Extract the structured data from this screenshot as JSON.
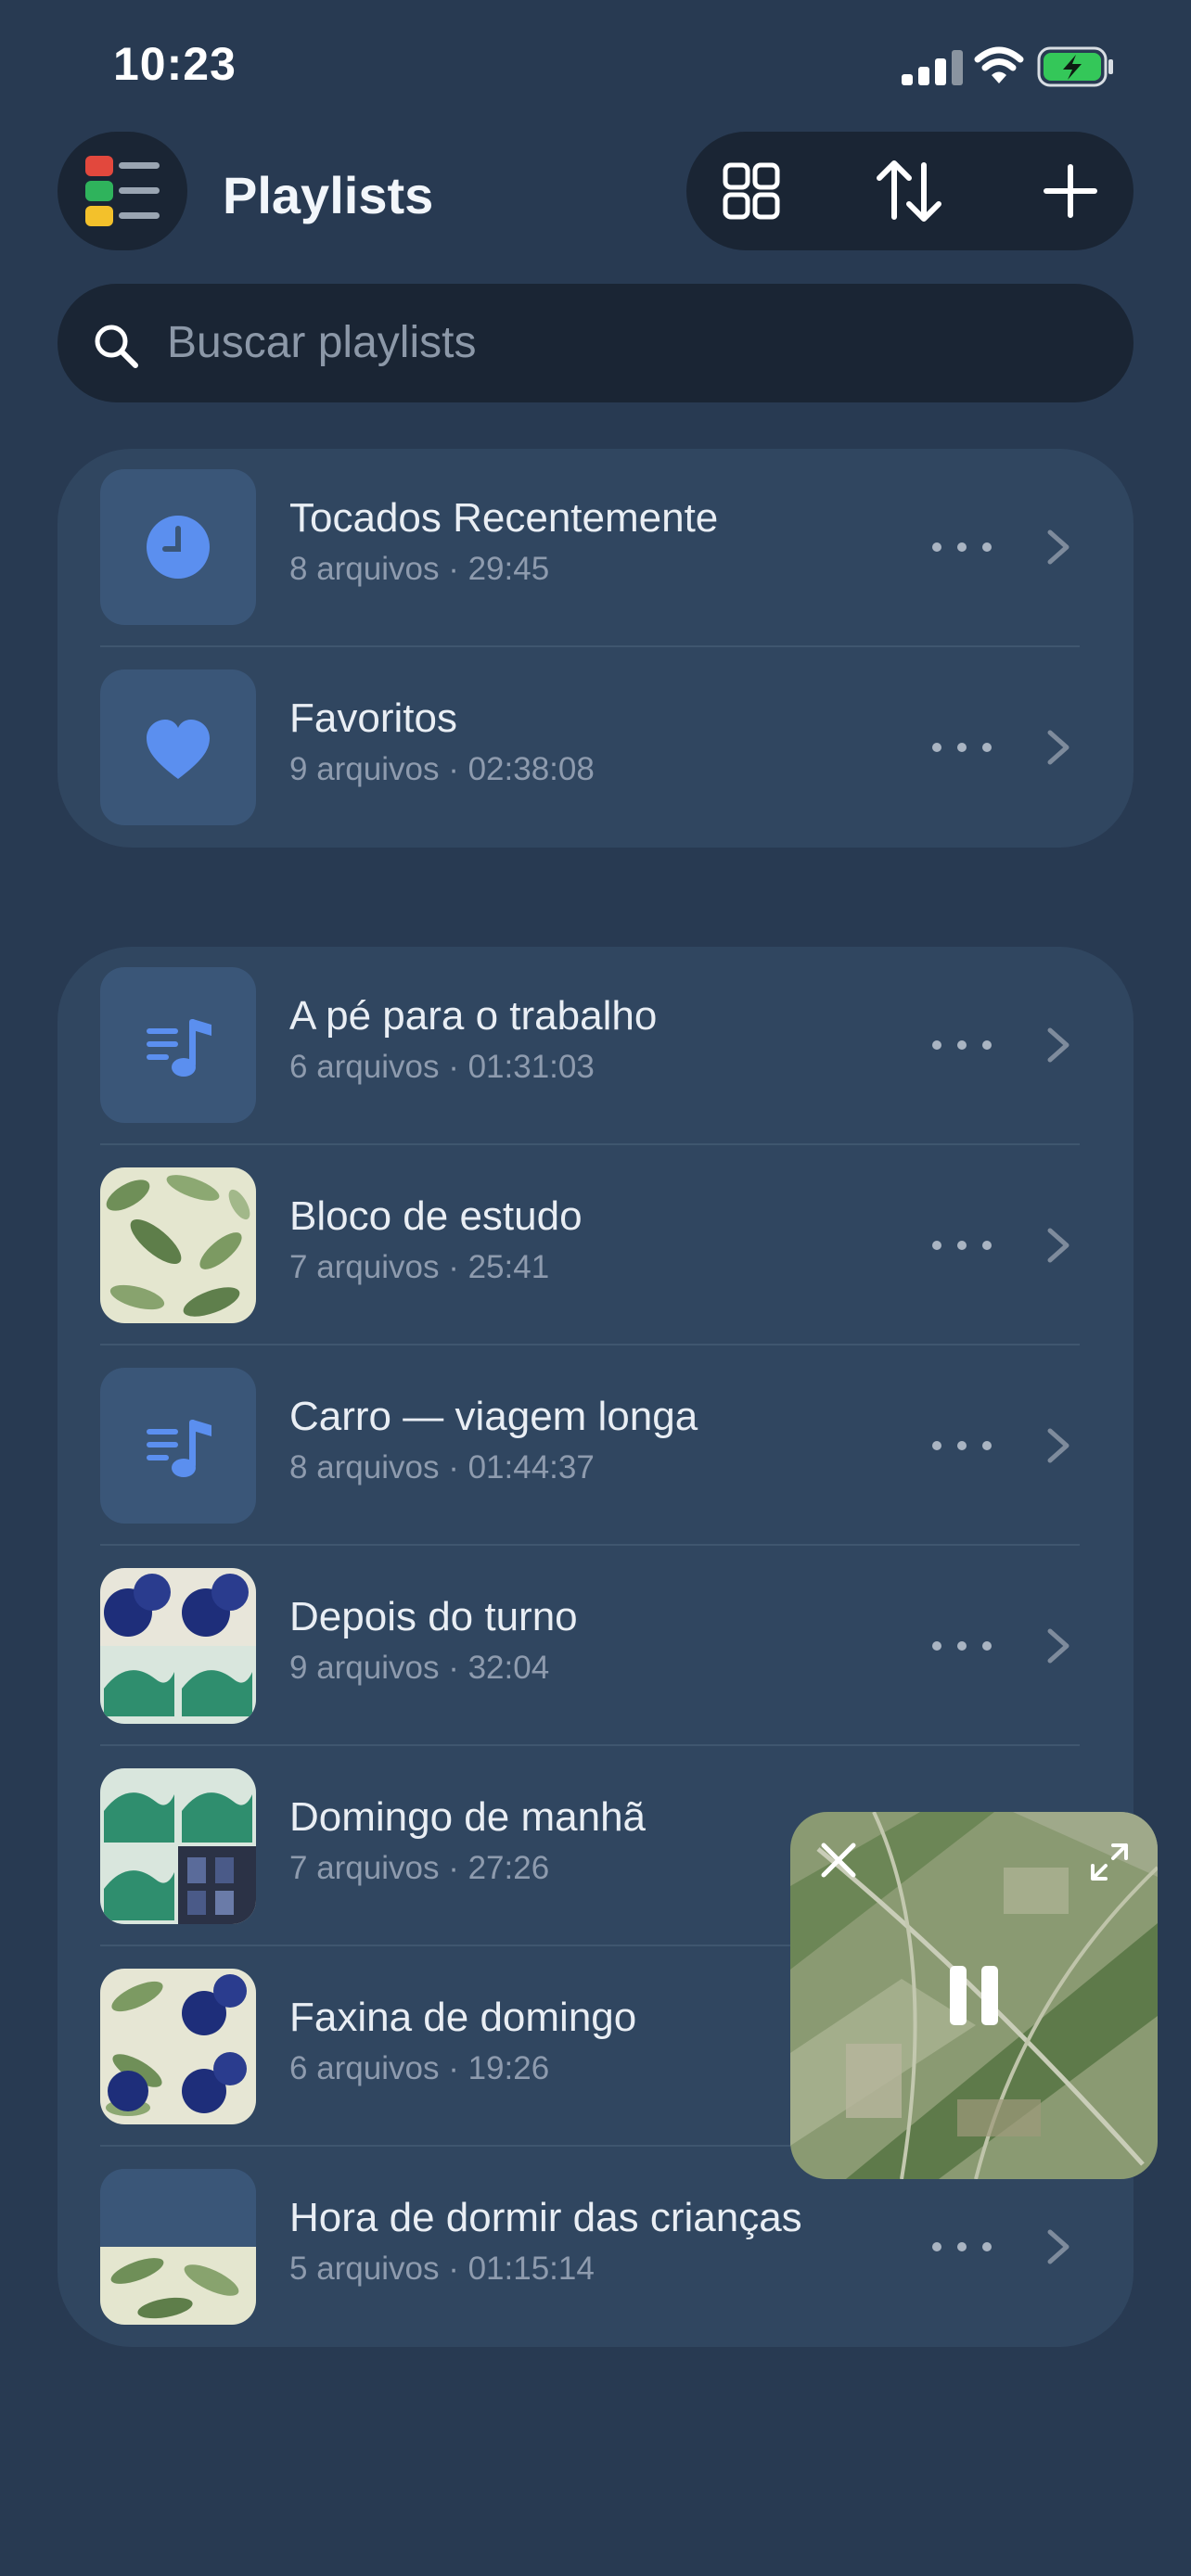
{
  "status_bar": {
    "time": "10:23",
    "battery": "charging"
  },
  "header": {
    "title": "Playlists",
    "menu_icon": "colored-list-menu-icon",
    "actions": [
      {
        "name": "grid-view",
        "icon": "grid-icon"
      },
      {
        "name": "sort",
        "icon": "sort-arrows-icon"
      },
      {
        "name": "add",
        "icon": "plus-icon"
      }
    ]
  },
  "search": {
    "placeholder": "Buscar playlists",
    "value": ""
  },
  "system_playlists": [
    {
      "name": "Tocados Recentemente",
      "meta": "8 arquivos · 29:45",
      "icon": "clock-icon"
    },
    {
      "name": "Favoritos",
      "meta": "9 arquivos · 02:38:08",
      "icon": "heart-icon"
    }
  ],
  "playlists": [
    {
      "name": "A pé para o trabalho",
      "meta": "6 arquivos · 01:31:03",
      "thumb": "music-list-icon"
    },
    {
      "name": "Bloco de estudo",
      "meta": "7 arquivos · 25:41",
      "thumb": "artwork-leaves"
    },
    {
      "name": "Carro — viagem longa",
      "meta": "8 arquivos · 01:44:37",
      "thumb": "music-list-icon"
    },
    {
      "name": "Depois do turno",
      "meta": "9 arquivos · 32:04",
      "thumb": "artwork-mosaic-blue-green"
    },
    {
      "name": "Domingo de manhã",
      "meta": "7 arquivos · 27:26",
      "thumb": "artwork-mosaic-green"
    },
    {
      "name": "Faxina de domingo",
      "meta": "6 arquivos · 19:26",
      "thumb": "artwork-mosaic-leaves-blue"
    },
    {
      "name": "Hora de dormir das crianças",
      "meta": "5 arquivos · 01:15:14",
      "thumb": "artwork-half-leaves"
    }
  ],
  "mini_player": {
    "state": "playing",
    "controls": [
      "close-icon",
      "pause-icon",
      "expand-icon"
    ]
  },
  "colors": {
    "background": "#283A52",
    "card": "#304660",
    "accent": "#5B8FEF",
    "battery": "#34C759"
  }
}
